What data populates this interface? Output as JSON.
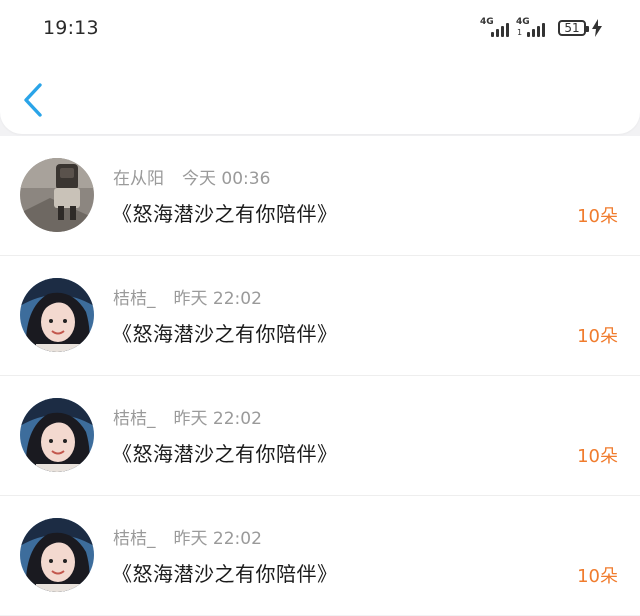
{
  "status_bar": {
    "time": "19:13",
    "network_1": "4G",
    "network_2": "4G",
    "network_2_sub": "1",
    "battery_level": "51",
    "charging": true
  },
  "header": {
    "back_icon": "chevron-left-icon",
    "accent_color": "#2aa4e8"
  },
  "records": [
    {
      "name": "在从阳",
      "time": "今天 00:36",
      "gift": "《怒海潜沙之有你陪伴》",
      "count": "10朵"
    },
    {
      "name": "桔桔_",
      "time": "昨天 22:02",
      "gift": "《怒海潜沙之有你陪伴》",
      "count": "10朵"
    },
    {
      "name": "桔桔_",
      "time": "昨天 22:02",
      "gift": "《怒海潜沙之有你陪伴》",
      "count": "10朵"
    },
    {
      "name": "桔桔_",
      "time": "昨天 22:02",
      "gift": "《怒海潜沙之有你陪伴》",
      "count": "10朵"
    }
  ],
  "colors": {
    "count_text": "#f07c2e",
    "meta_text": "#9a9a9a",
    "title_text": "#1a1a1a",
    "page_bg": "#f2f2f4"
  }
}
